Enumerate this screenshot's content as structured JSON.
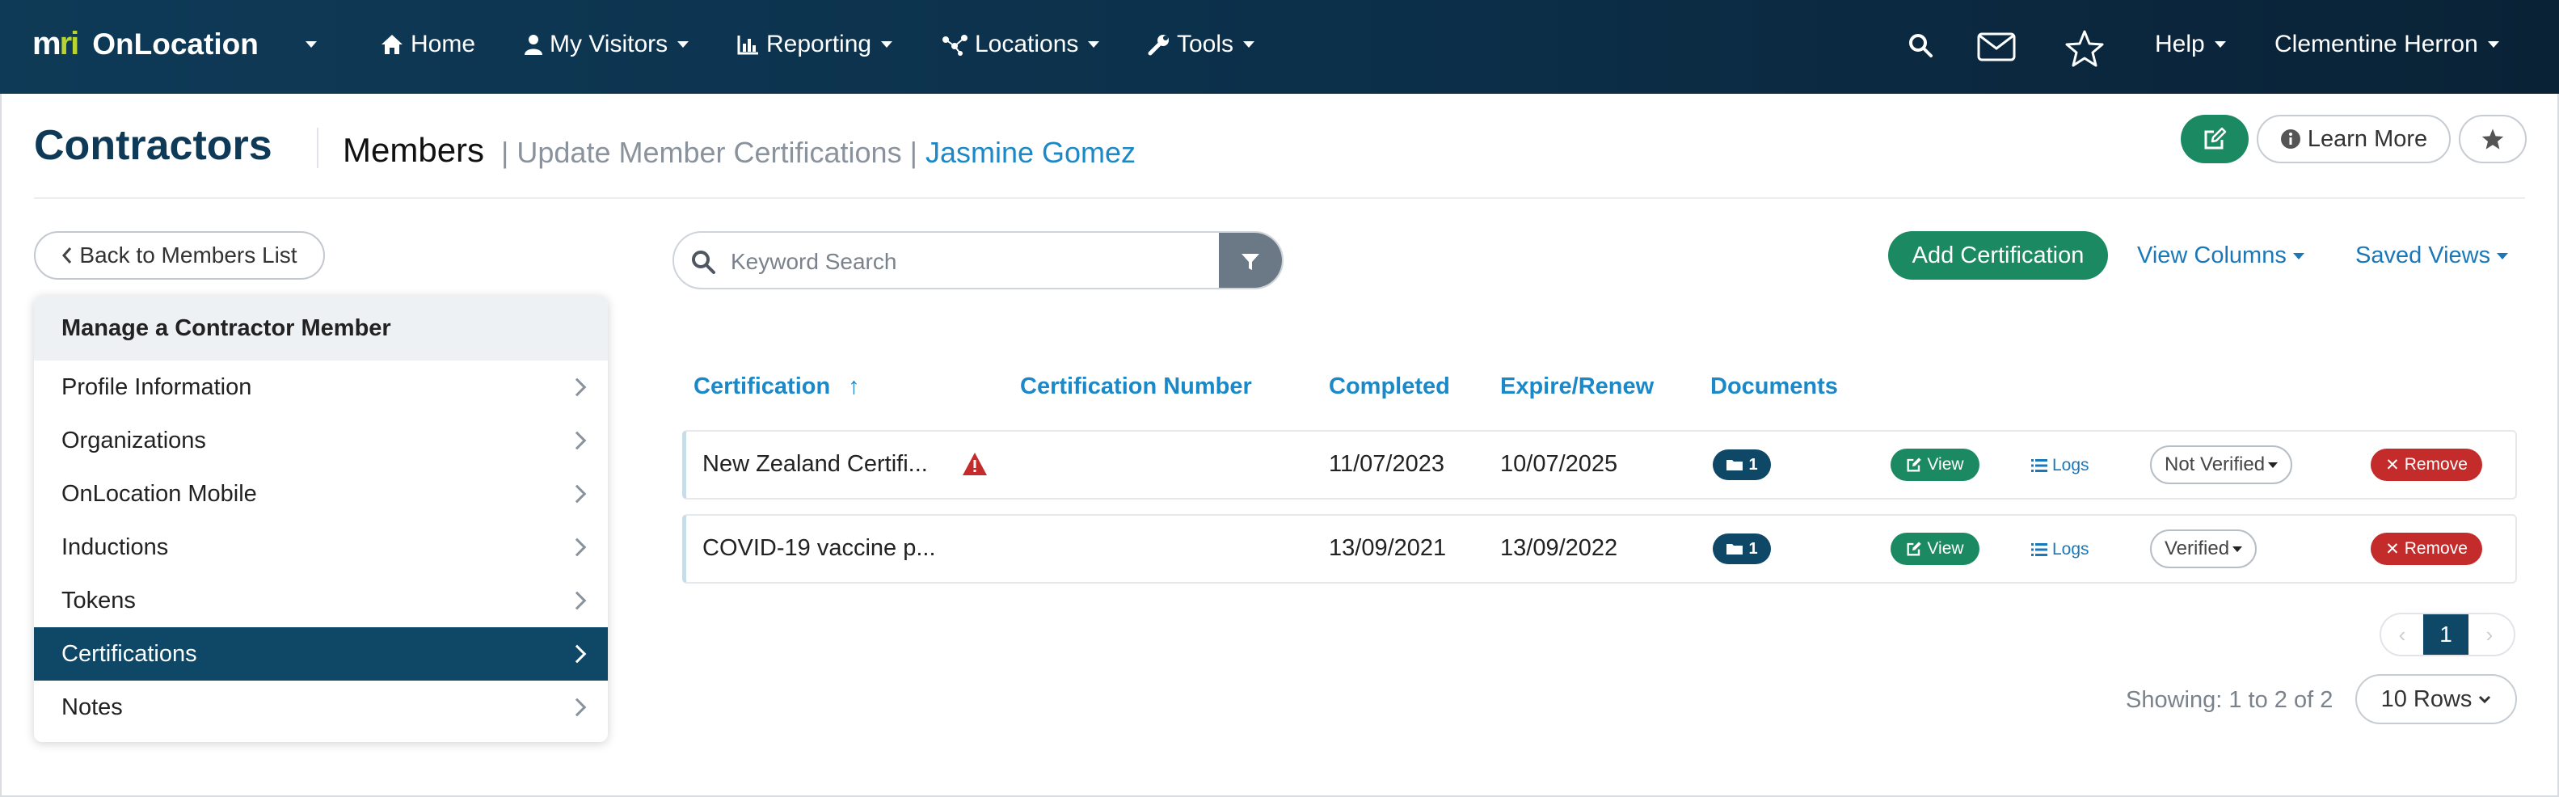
{
  "navbar": {
    "brand_mark_m": "m",
    "brand_mark_ri": "ri",
    "app_name": "OnLocation",
    "items": [
      {
        "label": "Home",
        "icon": "home-icon"
      },
      {
        "label": "My Visitors",
        "icon": "person-icon"
      },
      {
        "label": "Reporting",
        "icon": "bar-chart-icon"
      },
      {
        "label": "Locations",
        "icon": "network-icon"
      },
      {
        "label": "Tools",
        "icon": "wrench-icon"
      }
    ],
    "help_label": "Help",
    "user_name": "Clementine Herron"
  },
  "header": {
    "title": "Contractors",
    "members": "Members",
    "sep1": "|",
    "subpage": "Update Member Certifications",
    "sep2": "|",
    "person": "Jasmine Gomez",
    "learn_more": "Learn More"
  },
  "sidebar": {
    "back_label": "Back to Members List",
    "heading": "Manage a Contractor Member",
    "items": [
      {
        "label": "Profile Information"
      },
      {
        "label": "Organizations"
      },
      {
        "label": "OnLocation Mobile"
      },
      {
        "label": "Inductions"
      },
      {
        "label": "Tokens"
      },
      {
        "label": "Certifications"
      },
      {
        "label": "Notes"
      }
    ]
  },
  "toolbar": {
    "search_placeholder": "Keyword Search",
    "add_label": "Add Certification",
    "view_columns": "View Columns",
    "saved_views": "Saved Views"
  },
  "table": {
    "columns": [
      "Certification",
      "Certification Number",
      "Completed",
      "Expire/Renew",
      "Documents"
    ],
    "sort_arrow": "↑",
    "rows": [
      {
        "certification": "New Zealand Certifi...",
        "number": "",
        "completed": "11/07/2023",
        "expire": "10/07/2025",
        "documents": "1",
        "view": "View",
        "logs": "Logs",
        "status": "Not Verified",
        "remove": "Remove",
        "warning": true
      },
      {
        "certification": "COVID-19 vaccine p...",
        "number": "",
        "completed": "13/09/2021",
        "expire": "13/09/2022",
        "documents": "1",
        "view": "View",
        "logs": "Logs",
        "status": "Verified",
        "remove": "Remove",
        "warning": false
      }
    ]
  },
  "pagination": {
    "prev": "‹",
    "current": "1",
    "next": "›",
    "showing": "Showing: 1 to 2 of 2",
    "rows_label": "10 Rows"
  },
  "colors": {
    "nav_bg": "#0e3a57",
    "brand_green": "#1b8a63",
    "link_blue": "#1b88c8",
    "active_menu": "#0e4866",
    "danger": "#c42b2b"
  }
}
